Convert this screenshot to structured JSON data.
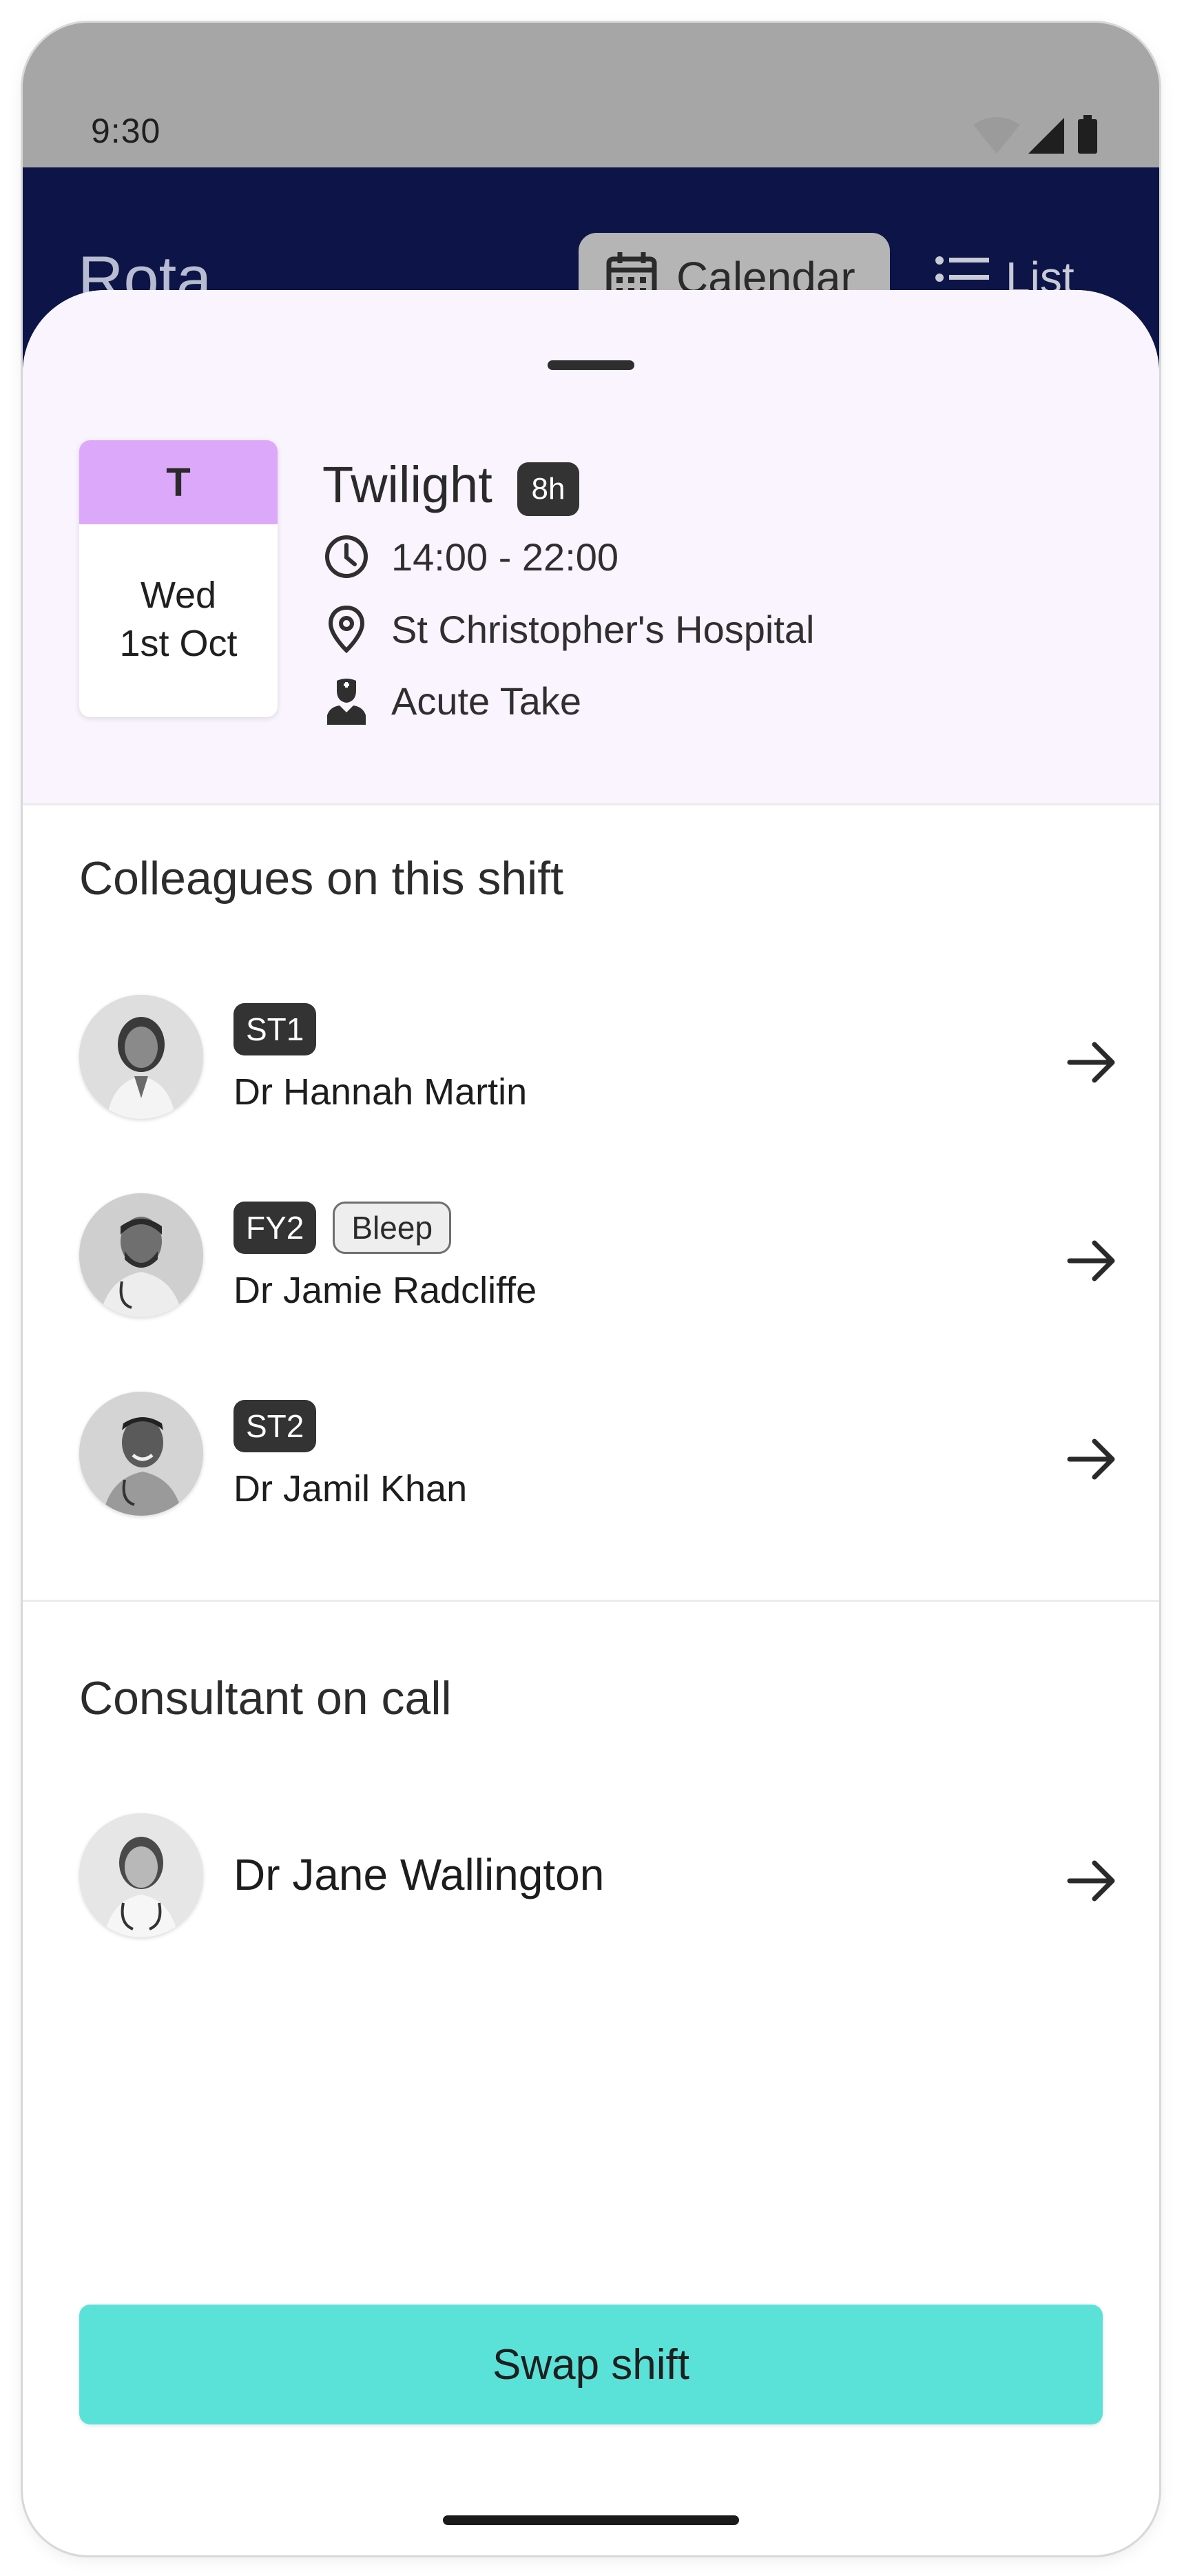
{
  "status_bar": {
    "time": "9:30"
  },
  "app_bar": {
    "title": "Rota",
    "views": [
      {
        "label": "Calendar",
        "icon": "calendar-icon",
        "selected": true
      },
      {
        "label": "List",
        "icon": "list-icon",
        "selected": false
      }
    ]
  },
  "shift": {
    "code": "T",
    "day": "Wed",
    "date": "1st Oct",
    "title": "Twilight",
    "duration": "8h",
    "time": "14:00 - 22:00",
    "location": "St Christopher's Hospital",
    "role": "Acute Take",
    "accent_color": "#dca8fa"
  },
  "colleagues": {
    "title": "Colleagues on this shift",
    "people": [
      {
        "grade": "ST1",
        "name": "Dr Hannah Martin"
      },
      {
        "grade": "FY2",
        "tag": "Bleep",
        "name": "Dr Jamie Radcliffe"
      },
      {
        "grade": "ST2",
        "name": "Dr Jamil Khan"
      }
    ]
  },
  "consultant": {
    "title": "Consultant on call",
    "name": "Dr Jane Wallington"
  },
  "actions": {
    "swap_label": "Swap shift",
    "swap_color": "#5ae2d9"
  }
}
